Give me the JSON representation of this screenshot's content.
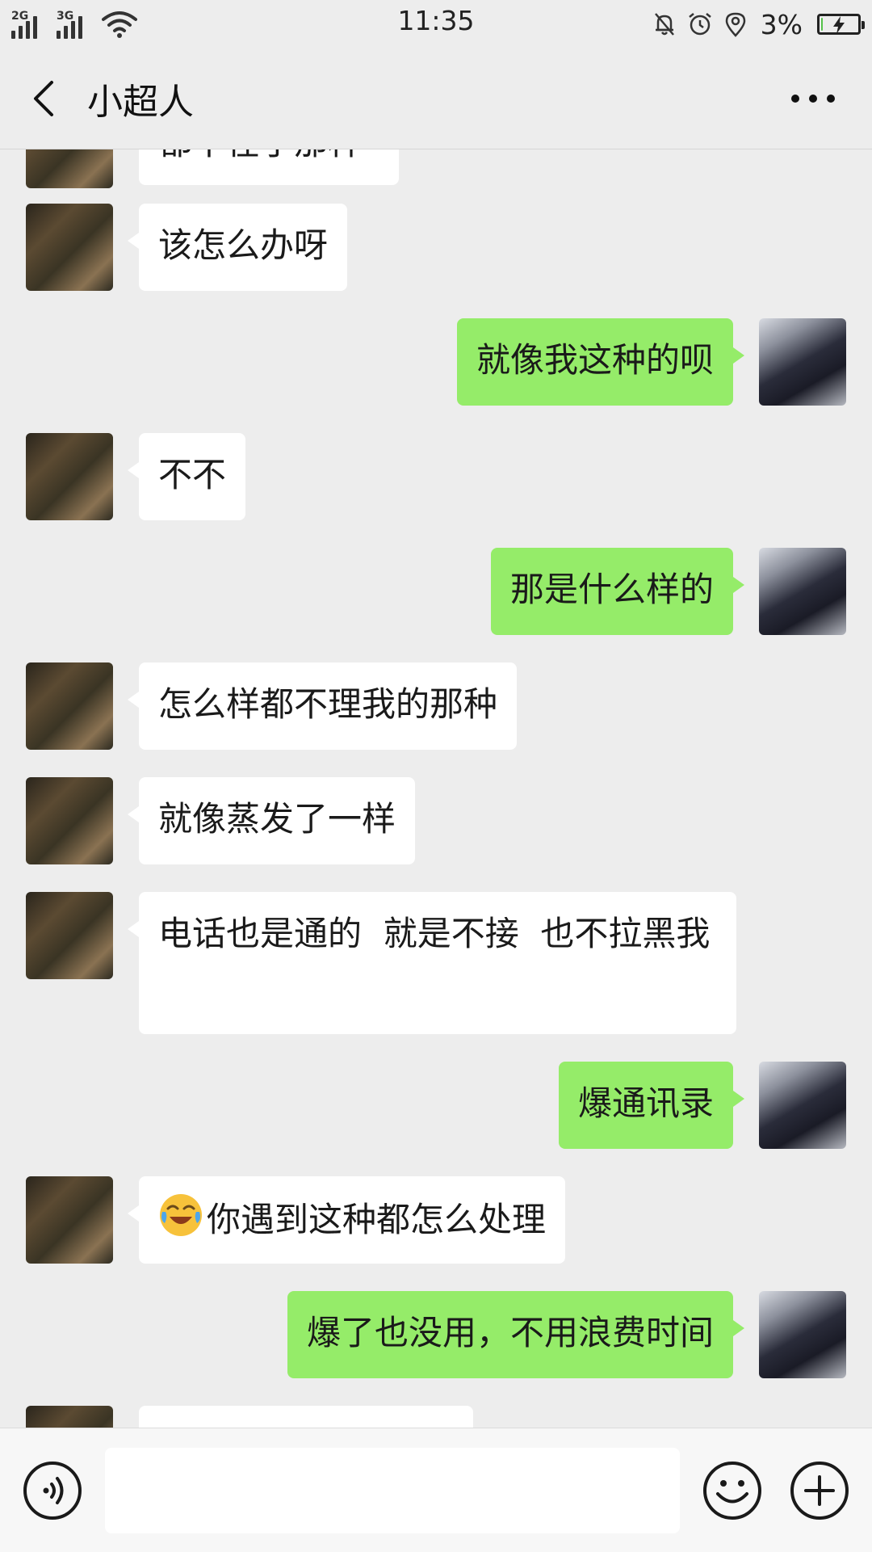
{
  "status_bar": {
    "time": "11:35",
    "signal_1": "2G",
    "signal_2": "3G",
    "battery": "3%",
    "battery_level": 0.03,
    "icons": [
      "signal-icon",
      "wifi-icon",
      "mute-bell-icon",
      "alarm-icon",
      "location-icon",
      "battery-charging-icon"
    ]
  },
  "header": {
    "title": "小超人",
    "back_icon": "chevron-left-icon",
    "more_icon": "more-dots-icon"
  },
  "messages": [
    {
      "side": "left",
      "text": "都不在乎那种"
    },
    {
      "side": "left",
      "text": "该怎么办呀"
    },
    {
      "side": "right",
      "text": "就像我这种的呗"
    },
    {
      "side": "left",
      "text": "不不"
    },
    {
      "side": "right",
      "text": "那是什么样的"
    },
    {
      "side": "left",
      "text": "怎么样都不理我的那种"
    },
    {
      "side": "left",
      "text": "就像蒸发了一样"
    },
    {
      "side": "left",
      "text": "电话也是通的  就是不接  也不拉黑我"
    },
    {
      "side": "right",
      "text": "爆通讯录"
    },
    {
      "side": "left",
      "emoji": "crying-laughing-emoji",
      "text": "你遇到这种都怎么处理"
    },
    {
      "side": "right",
      "text": "爆了也没用，不用浪费时间"
    },
    {
      "side": "left",
      "text": ""
    }
  ],
  "input_bar": {
    "voice_icon": "voice-icon",
    "input_value": "",
    "emoji_icon": "smiley-icon",
    "plus_icon": "plus-icon"
  },
  "colors": {
    "background": "#ededed",
    "sent_bubble": "#95ec69",
    "received_bubble": "#ffffff"
  }
}
